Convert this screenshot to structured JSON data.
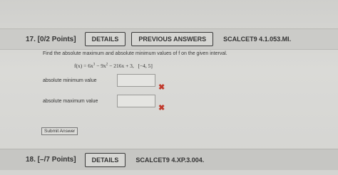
{
  "q17": {
    "number_points": "17. [0/2 Points]",
    "details_label": "DETAILS",
    "previous_answers_label": "PREVIOUS ANSWERS",
    "code": "SCALCET9 4.1.053.MI.",
    "prompt": "Find the absolute maximum and absolute minimum values of f on the given interval.",
    "function_lhs": "f(x) = 6x",
    "exp3": "3",
    "function_mid": " − 9x",
    "exp2": "2",
    "function_rhs": " − 216x + 3,",
    "interval": "[−4, 5]",
    "min_label": "absolute minimum value",
    "min_value": "",
    "max_label": "absolute maximum value",
    "max_value": "",
    "incorrect_mark": "✖",
    "submit_label": "Submit Answer"
  },
  "q18": {
    "number_points": "18. [–/7 Points]",
    "details_label": "DETAILS",
    "code": "SCALCET9 4.XP.3.004."
  },
  "colors": {
    "incorrect": "#c0392b"
  }
}
